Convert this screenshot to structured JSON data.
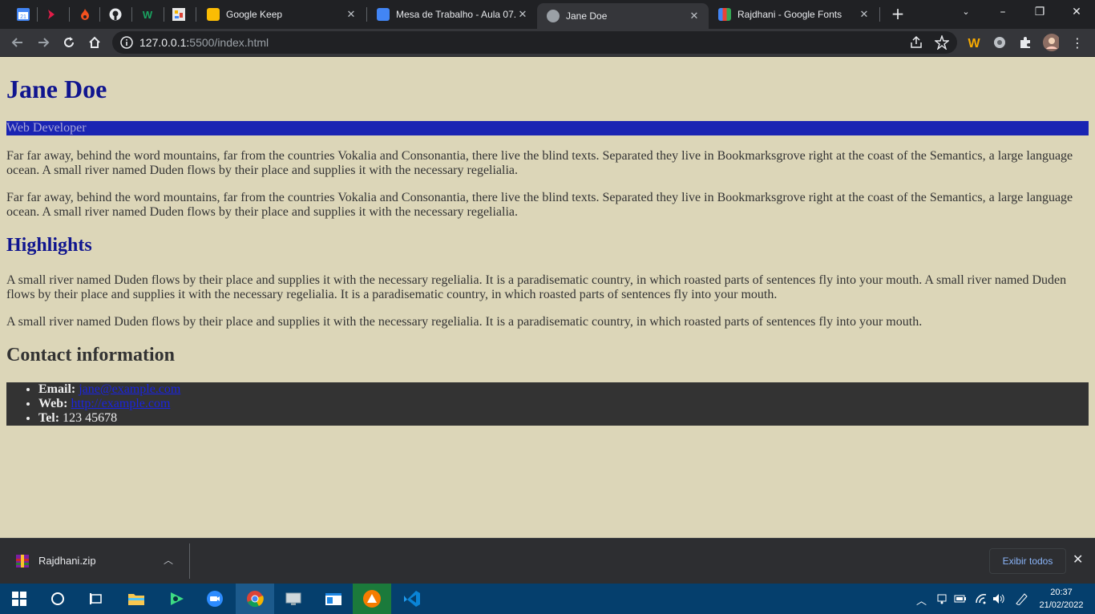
{
  "browser": {
    "tabs": [
      {
        "title": "Google Keep",
        "active": false
      },
      {
        "title": "Mesa de Trabalho - Aula 07.",
        "active": false
      },
      {
        "title": "Jane Doe",
        "active": true
      },
      {
        "title": "Rajdhani - Google Fonts",
        "active": false
      }
    ],
    "url_host": "127.0.0.1:",
    "url_rest": "5500/index.html"
  },
  "page": {
    "name": "Jane Doe",
    "role": "Web Developer",
    "intro": [
      "Far far away, behind the word mountains, far from the countries Vokalia and Consonantia, there live the blind texts. Separated they live in Bookmarksgrove right at the coast of the Semantics, a large language ocean. A small river named Duden flows by their place and supplies it with the necessary regelialia.",
      "Far far away, behind the word mountains, far from the countries Vokalia and Consonantia, there live the blind texts. Separated they live in Bookmarksgrove right at the coast of the Semantics, a large language ocean. A small river named Duden flows by their place and supplies it with the necessary regelialia."
    ],
    "highlights_heading": "Highlights",
    "highlights": [
      "A small river named Duden flows by their place and supplies it with the necessary regelialia. It is a paradisematic country, in which roasted parts of sentences fly into your mouth. A small river named Duden flows by their place and supplies it with the necessary regelialia. It is a paradisematic country, in which roasted parts of sentences fly into your mouth.",
      "A small river named Duden flows by their place and supplies it with the necessary regelialia. It is a paradisematic country, in which roasted parts of sentences fly into your mouth."
    ],
    "contact_heading": "Contact information",
    "contact": {
      "email_label": "Email:",
      "email": "jane@example.com",
      "web_label": "Web:",
      "web": "http://example.com",
      "tel_label": "Tel:",
      "tel": "123 45678"
    }
  },
  "downloads": {
    "file": "Rajdhani.zip",
    "show_all": "Exibir todos"
  },
  "taskbar": {
    "time": "20:37",
    "date": "21/02/2022"
  },
  "colors": {
    "page_bg": "#dcd6b8",
    "heading_blue": "#10158f",
    "role_bar": "#1a24b3",
    "contact_bg": "#333333"
  }
}
